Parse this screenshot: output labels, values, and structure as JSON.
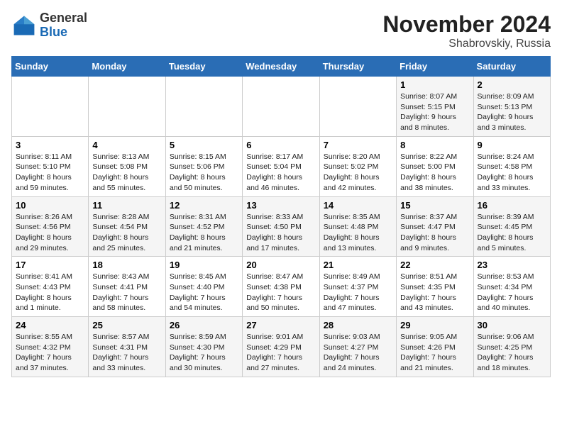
{
  "logo": {
    "general": "General",
    "blue": "Blue"
  },
  "header": {
    "title": "November 2024",
    "subtitle": "Shabrovskiy, Russia"
  },
  "days_of_week": [
    "Sunday",
    "Monday",
    "Tuesday",
    "Wednesday",
    "Thursday",
    "Friday",
    "Saturday"
  ],
  "weeks": [
    [
      {
        "day": "",
        "info": ""
      },
      {
        "day": "",
        "info": ""
      },
      {
        "day": "",
        "info": ""
      },
      {
        "day": "",
        "info": ""
      },
      {
        "day": "",
        "info": ""
      },
      {
        "day": "1",
        "info": "Sunrise: 8:07 AM\nSunset: 5:15 PM\nDaylight: 9 hours and 8 minutes."
      },
      {
        "day": "2",
        "info": "Sunrise: 8:09 AM\nSunset: 5:13 PM\nDaylight: 9 hours and 3 minutes."
      }
    ],
    [
      {
        "day": "3",
        "info": "Sunrise: 8:11 AM\nSunset: 5:10 PM\nDaylight: 8 hours and 59 minutes."
      },
      {
        "day": "4",
        "info": "Sunrise: 8:13 AM\nSunset: 5:08 PM\nDaylight: 8 hours and 55 minutes."
      },
      {
        "day": "5",
        "info": "Sunrise: 8:15 AM\nSunset: 5:06 PM\nDaylight: 8 hours and 50 minutes."
      },
      {
        "day": "6",
        "info": "Sunrise: 8:17 AM\nSunset: 5:04 PM\nDaylight: 8 hours and 46 minutes."
      },
      {
        "day": "7",
        "info": "Sunrise: 8:20 AM\nSunset: 5:02 PM\nDaylight: 8 hours and 42 minutes."
      },
      {
        "day": "8",
        "info": "Sunrise: 8:22 AM\nSunset: 5:00 PM\nDaylight: 8 hours and 38 minutes."
      },
      {
        "day": "9",
        "info": "Sunrise: 8:24 AM\nSunset: 4:58 PM\nDaylight: 8 hours and 33 minutes."
      }
    ],
    [
      {
        "day": "10",
        "info": "Sunrise: 8:26 AM\nSunset: 4:56 PM\nDaylight: 8 hours and 29 minutes."
      },
      {
        "day": "11",
        "info": "Sunrise: 8:28 AM\nSunset: 4:54 PM\nDaylight: 8 hours and 25 minutes."
      },
      {
        "day": "12",
        "info": "Sunrise: 8:31 AM\nSunset: 4:52 PM\nDaylight: 8 hours and 21 minutes."
      },
      {
        "day": "13",
        "info": "Sunrise: 8:33 AM\nSunset: 4:50 PM\nDaylight: 8 hours and 17 minutes."
      },
      {
        "day": "14",
        "info": "Sunrise: 8:35 AM\nSunset: 4:48 PM\nDaylight: 8 hours and 13 minutes."
      },
      {
        "day": "15",
        "info": "Sunrise: 8:37 AM\nSunset: 4:47 PM\nDaylight: 8 hours and 9 minutes."
      },
      {
        "day": "16",
        "info": "Sunrise: 8:39 AM\nSunset: 4:45 PM\nDaylight: 8 hours and 5 minutes."
      }
    ],
    [
      {
        "day": "17",
        "info": "Sunrise: 8:41 AM\nSunset: 4:43 PM\nDaylight: 8 hours and 1 minute."
      },
      {
        "day": "18",
        "info": "Sunrise: 8:43 AM\nSunset: 4:41 PM\nDaylight: 7 hours and 58 minutes."
      },
      {
        "day": "19",
        "info": "Sunrise: 8:45 AM\nSunset: 4:40 PM\nDaylight: 7 hours and 54 minutes."
      },
      {
        "day": "20",
        "info": "Sunrise: 8:47 AM\nSunset: 4:38 PM\nDaylight: 7 hours and 50 minutes."
      },
      {
        "day": "21",
        "info": "Sunrise: 8:49 AM\nSunset: 4:37 PM\nDaylight: 7 hours and 47 minutes."
      },
      {
        "day": "22",
        "info": "Sunrise: 8:51 AM\nSunset: 4:35 PM\nDaylight: 7 hours and 43 minutes."
      },
      {
        "day": "23",
        "info": "Sunrise: 8:53 AM\nSunset: 4:34 PM\nDaylight: 7 hours and 40 minutes."
      }
    ],
    [
      {
        "day": "24",
        "info": "Sunrise: 8:55 AM\nSunset: 4:32 PM\nDaylight: 7 hours and 37 minutes."
      },
      {
        "day": "25",
        "info": "Sunrise: 8:57 AM\nSunset: 4:31 PM\nDaylight: 7 hours and 33 minutes."
      },
      {
        "day": "26",
        "info": "Sunrise: 8:59 AM\nSunset: 4:30 PM\nDaylight: 7 hours and 30 minutes."
      },
      {
        "day": "27",
        "info": "Sunrise: 9:01 AM\nSunset: 4:29 PM\nDaylight: 7 hours and 27 minutes."
      },
      {
        "day": "28",
        "info": "Sunrise: 9:03 AM\nSunset: 4:27 PM\nDaylight: 7 hours and 24 minutes."
      },
      {
        "day": "29",
        "info": "Sunrise: 9:05 AM\nSunset: 4:26 PM\nDaylight: 7 hours and 21 minutes."
      },
      {
        "day": "30",
        "info": "Sunrise: 9:06 AM\nSunset: 4:25 PM\nDaylight: 7 hours and 18 minutes."
      }
    ]
  ]
}
